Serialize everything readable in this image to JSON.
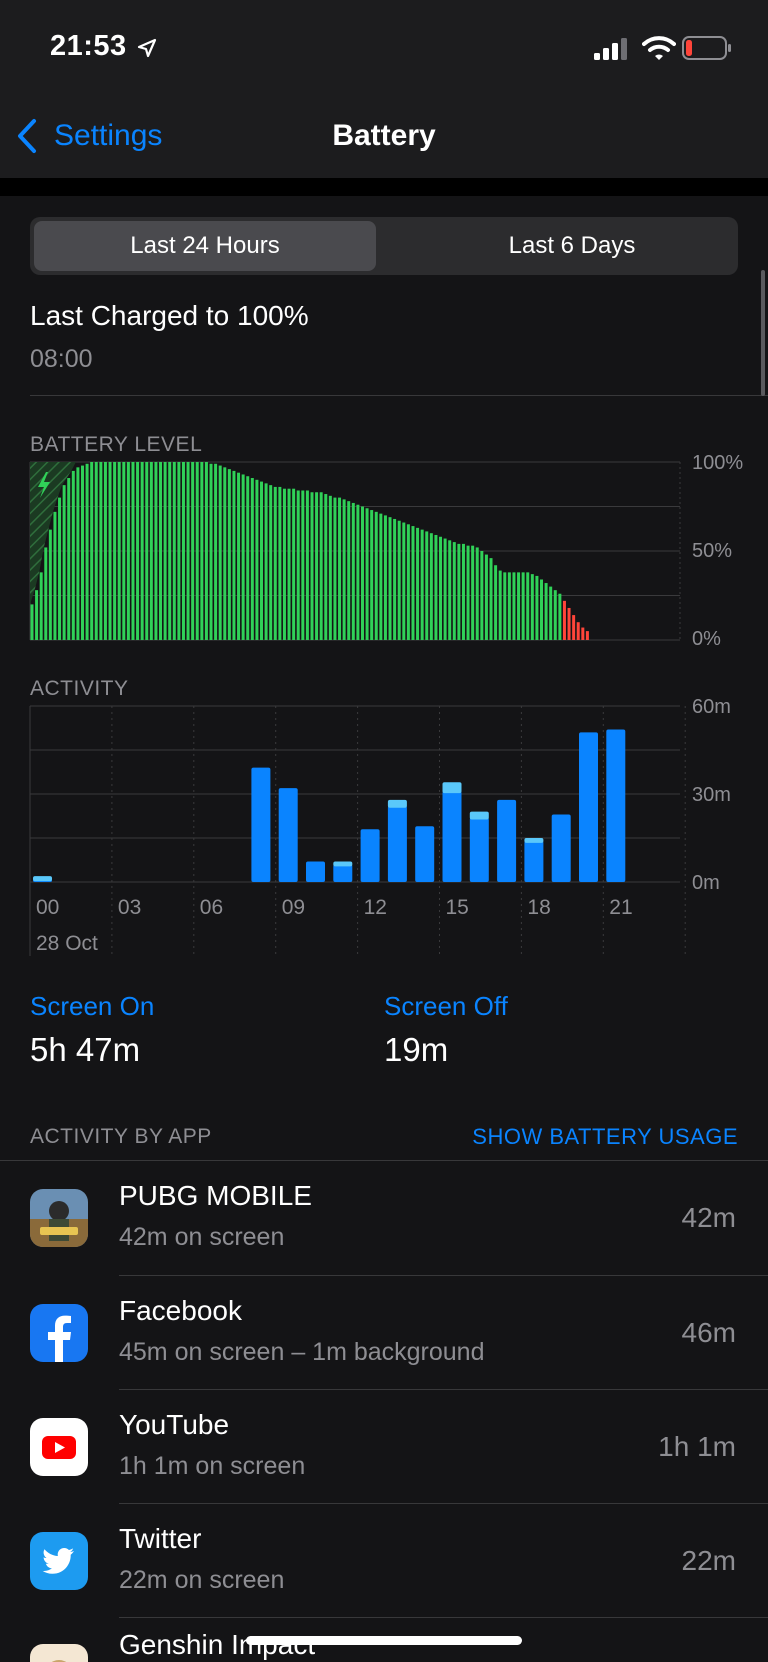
{
  "status": {
    "time": "21:53"
  },
  "nav": {
    "back_label": "Settings",
    "title": "Battery"
  },
  "tabs": [
    {
      "label": "Last 24 Hours",
      "active": true
    },
    {
      "label": "Last 6 Days",
      "active": false
    }
  ],
  "last_charged": {
    "title": "Last Charged to 100%",
    "time": "08:00"
  },
  "battery_chart": {
    "label": "BATTERY LEVEL",
    "y_ticks": [
      "100%",
      "50%",
      "0%"
    ]
  },
  "activity_chart": {
    "label": "ACTIVITY",
    "y_ticks": [
      "60m",
      "30m",
      "0m"
    ],
    "x_ticks": [
      "00",
      "03",
      "06",
      "09",
      "12",
      "15",
      "18",
      "21"
    ],
    "date_label": "28 Oct"
  },
  "chart_data": [
    {
      "type": "bar",
      "title": "BATTERY LEVEL",
      "ylim": [
        0,
        100
      ],
      "unit": "%",
      "values": [
        20,
        28,
        38,
        52,
        62,
        72,
        80,
        87,
        91,
        95,
        97,
        98,
        99,
        100,
        100,
        100,
        100,
        100,
        100,
        100,
        100,
        100,
        100,
        100,
        100,
        100,
        100,
        100,
        100,
        100,
        100,
        100,
        100,
        100,
        100,
        100,
        100,
        100,
        100,
        99,
        99,
        98,
        97,
        96,
        95,
        94,
        93,
        92,
        91,
        90,
        89,
        88,
        87,
        86,
        86,
        85,
        85,
        85,
        84,
        84,
        84,
        83,
        83,
        83,
        82,
        81,
        80,
        80,
        79,
        78,
        77,
        76,
        75,
        74,
        73,
        72,
        71,
        70,
        69,
        68,
        67,
        66,
        65,
        64,
        63,
        62,
        61,
        60,
        59,
        58,
        57,
        56,
        55,
        54,
        54,
        53,
        53,
        52,
        50,
        48,
        46,
        42,
        39,
        38,
        38,
        38,
        38,
        38,
        38,
        37,
        36,
        34,
        32,
        30,
        28,
        26,
        22,
        18,
        14,
        10,
        7,
        5
      ],
      "low_threshold_index": 116,
      "charging_until_index": 10,
      "colors": {
        "normal": "#30d158",
        "low": "#ff453a"
      }
    },
    {
      "type": "bar",
      "title": "ACTIVITY",
      "categories": [
        "00",
        "01",
        "02",
        "03",
        "04",
        "05",
        "06",
        "07",
        "08",
        "09",
        "10",
        "11",
        "12",
        "13",
        "14",
        "15",
        "16",
        "17",
        "18",
        "19",
        "20",
        "21"
      ],
      "ylim": [
        0,
        60
      ],
      "unit": "m",
      "series": [
        {
          "name": "Screen On",
          "color": "#0a84ff",
          "values": [
            1,
            0,
            0,
            0,
            0,
            0,
            0,
            0,
            39,
            32,
            7,
            6,
            18,
            26,
            19,
            31,
            22,
            28,
            14,
            23,
            51,
            52
          ]
        },
        {
          "name": "Screen Off",
          "color": "#5ac8fa",
          "values": [
            1,
            0,
            0,
            0,
            0,
            0,
            0,
            0,
            0,
            0,
            0,
            1,
            0,
            2,
            0,
            3,
            2,
            0,
            1,
            0,
            0,
            0
          ]
        }
      ]
    }
  ],
  "screen_on": {
    "label": "Screen On",
    "value": "5h 47m"
  },
  "screen_off": {
    "label": "Screen Off",
    "value": "19m"
  },
  "activity_by_app": {
    "label": "ACTIVITY BY APP",
    "link": "SHOW BATTERY USAGE",
    "apps": [
      {
        "name": "PUBG MOBILE",
        "detail": "42m on screen",
        "time": "42m",
        "icon": "pubg-icon"
      },
      {
        "name": "Facebook",
        "detail": "45m on screen – 1m background",
        "time": "46m",
        "icon": "facebook-icon"
      },
      {
        "name": "YouTube",
        "detail": "1h 1m on screen",
        "time": "1h 1m",
        "icon": "youtube-icon"
      },
      {
        "name": "Twitter",
        "detail": "22m on screen",
        "time": "22m",
        "icon": "twitter-icon"
      },
      {
        "name": "Genshin Impact",
        "icon": "genshin-icon"
      }
    ]
  }
}
